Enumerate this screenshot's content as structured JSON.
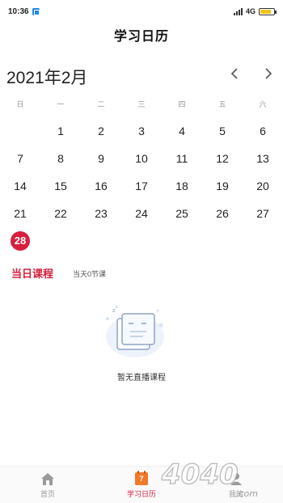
{
  "status_bar": {
    "time": "10:36",
    "network": "4G",
    "battery_level": 0.8,
    "battery_color": "#f0c419"
  },
  "header": {
    "title": "学习日历"
  },
  "calendar": {
    "month_label": "2021年2月",
    "prev_icon": "chevron-left-icon",
    "next_icon": "chevron-right-icon",
    "weekdays": [
      "日",
      "一",
      "二",
      "三",
      "四",
      "五",
      "六"
    ],
    "first_weekday_index": 1,
    "days": [
      1,
      2,
      3,
      4,
      5,
      6,
      7,
      8,
      9,
      10,
      11,
      12,
      13,
      14,
      15,
      16,
      17,
      18,
      19,
      20,
      21,
      22,
      23,
      24,
      25,
      26,
      27,
      28
    ],
    "today": 28,
    "accent_color": "#d81e3d"
  },
  "course": {
    "tab_label": "当日课程",
    "count_text": "当天0节课"
  },
  "empty_state": {
    "icon": "empty-box-icon",
    "text": "暂无直播课程"
  },
  "tab_bar": {
    "tabs": [
      {
        "label": "首页",
        "icon": "home-icon",
        "active": false
      },
      {
        "label": "学习日历",
        "icon": "calendar-icon",
        "icon_text": "7",
        "active": true
      },
      {
        "label": "我的",
        "icon": "person-icon",
        "active": false
      }
    ]
  },
  "watermark": {
    "text": "4040.com"
  }
}
